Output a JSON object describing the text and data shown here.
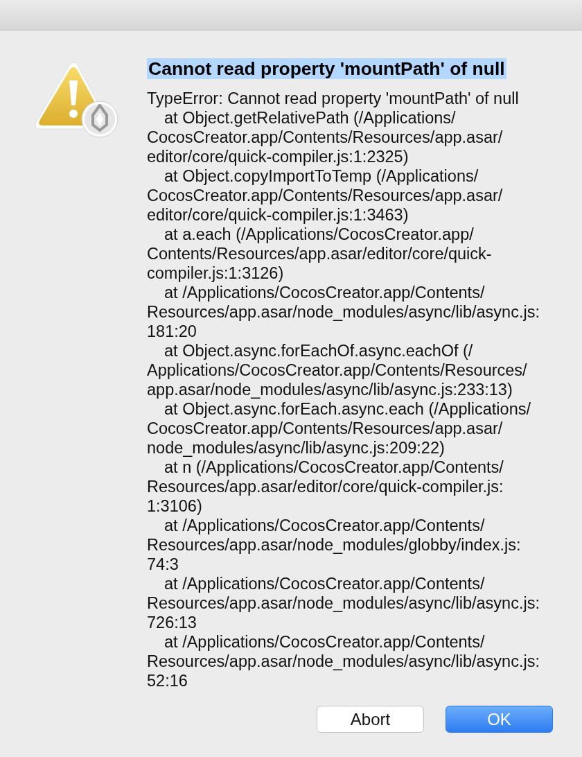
{
  "dialog": {
    "title": {
      "text": "Cannot read property 'mountPath' of null",
      "selected": true
    },
    "message_lines": [
      {
        "text": "TypeError: Cannot read property 'mountPath' of null",
        "indent": false
      },
      {
        "text": "at Object.getRelativePath (/Applications/",
        "indent": true
      },
      {
        "text": "CocosCreator.app/Contents/Resources/app.asar/",
        "indent": false
      },
      {
        "text": "editor/core/quick-compiler.js:1:2325)",
        "indent": false
      },
      {
        "text": "at Object.copyImportToTemp (/Applications/",
        "indent": true
      },
      {
        "text": "CocosCreator.app/Contents/Resources/app.asar/",
        "indent": false
      },
      {
        "text": "editor/core/quick-compiler.js:1:3463)",
        "indent": false
      },
      {
        "text": "at a.each (/Applications/CocosCreator.app/",
        "indent": true
      },
      {
        "text": "Contents/Resources/app.asar/editor/core/quick-",
        "indent": false
      },
      {
        "text": "compiler.js:1:3126)",
        "indent": false
      },
      {
        "text": "at /Applications/CocosCreator.app/Contents/",
        "indent": true
      },
      {
        "text": "Resources/app.asar/node_modules/async/lib/async.js:",
        "indent": false
      },
      {
        "text": "181:20",
        "indent": false
      },
      {
        "text": "at Object.async.forEachOf.async.eachOf (/",
        "indent": true
      },
      {
        "text": "Applications/CocosCreator.app/Contents/Resources/",
        "indent": false
      },
      {
        "text": "app.asar/node_modules/async/lib/async.js:233:13)",
        "indent": false
      },
      {
        "text": "at Object.async.forEach.async.each (/Applications/",
        "indent": true
      },
      {
        "text": "CocosCreator.app/Contents/Resources/app.asar/",
        "indent": false
      },
      {
        "text": "node_modules/async/lib/async.js:209:22)",
        "indent": false
      },
      {
        "text": "at n (/Applications/CocosCreator.app/Contents/",
        "indent": true
      },
      {
        "text": "Resources/app.asar/editor/core/quick-compiler.js:",
        "indent": false
      },
      {
        "text": "1:3106)",
        "indent": false
      },
      {
        "text": "at /Applications/CocosCreator.app/Contents/",
        "indent": true
      },
      {
        "text": "Resources/app.asar/node_modules/globby/index.js:",
        "indent": false
      },
      {
        "text": "74:3",
        "indent": false
      },
      {
        "text": "at /Applications/CocosCreator.app/Contents/",
        "indent": true
      },
      {
        "text": "Resources/app.asar/node_modules/async/lib/async.js:",
        "indent": false
      },
      {
        "text": "726:13",
        "indent": false
      },
      {
        "text": "at /Applications/CocosCreator.app/Contents/",
        "indent": true
      },
      {
        "text": "Resources/app.asar/node_modules/async/lib/async.js:",
        "indent": false
      },
      {
        "text": "52:16",
        "indent": false
      }
    ],
    "buttons": [
      {
        "label": "Abort",
        "kind": "secondary"
      },
      {
        "label": "OK",
        "kind": "default"
      }
    ]
  }
}
